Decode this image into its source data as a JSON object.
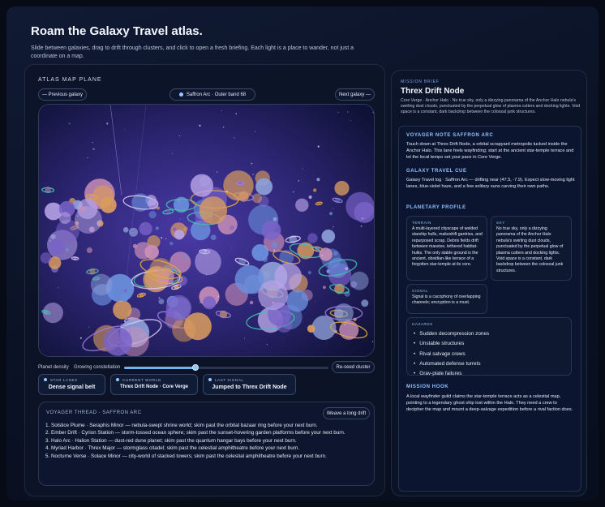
{
  "header": {
    "title": "Roam the Galaxy Travel atlas.",
    "subtitle": "Slide between galaxies, drag to drift through clusters, and click to open a fresh briefing. Each light is a place to wander, not just a coordinate on a map."
  },
  "atlas": {
    "section_label": "ATLAS MAP PLANE",
    "prev_label": "— Previous galaxy",
    "next_label": "Next galaxy —",
    "location_chip": "Saffron Arc · Outer band 68"
  },
  "density": {
    "label": "Planet density",
    "value_text": "Growing constellation",
    "value": 0.35,
    "reseed_label": "Re-seed cluster"
  },
  "stats": [
    {
      "key": "STAR LANES",
      "value": "Dense signal belt"
    },
    {
      "key": "CURRENT WORLD",
      "value": "Threx Drift Node · Core Verge"
    },
    {
      "key": "LAST SIGNAL",
      "value": "Jumped to Threx Drift Node"
    }
  ],
  "thread": {
    "title": "VOYAGER THREAD · SAFFRON ARC",
    "button_label": "Weave a long drift",
    "items": [
      "1. Solstice Plume · Seraphis Minor — nebula-swept shrine world; skim past the orbital bazaar ring before your next burn.",
      "2. Ember Drift · Cyrion Station — storm-tossed ocean sphere; skim past the sunset-hovering garden platforms before your next burn.",
      "3. Halo Arc · Halion Station — dust-red dune planet; skim past the quantum hangar bays before your next burn.",
      "4. Myriad Harbor · Threx Major — stormglass citadel; skim past the celestial amphitheatre before your next burn.",
      "5. Nocturne Verse · Solace Minor — city-world of stacked towers; skim past the celestial amphitheatre before your next burn."
    ]
  },
  "brief": {
    "label": "MISSION BRIEF",
    "title": "Threx Drift Node",
    "summary": "Core Verge · Anchor Halo · No true sky, only a dizzying panorama of the Anchor Halo nebula's swirling dust clouds, punctuated by the perpetual glow of plasma cutters and docking lights. Void space is a constant, dark backdrop between the colossal junk structures.",
    "voyager_note_title": "VOYAGER NOTE SAFFRON ARC",
    "voyager_note": "Touch down at Threx Drift Node, a orbital scrapyard metropolis tucked inside the Anchor Halo. This lane feels wayfinding; start at the ancient star-temple terrace and let the local tempo set your pace in Core Verge.",
    "cue_title": "GALAXY TRAVEL CUE",
    "cue": "Galaxy Travel log · Saffron Arc — drifting near (47.5, -7.9). Expect slow-moving light lanes, blue-violet haze, and a few solitary suns carving their own paths.",
    "profile_title": "PLANETARY PROFILE",
    "terrain_label": "TERRAIN",
    "terrain": "A multi-layered cityscape of welded starship hulls, makeshift gantries, and repurposed scrap. Debris fields drift between massive, tethered habitat-hulks. The only stable ground is the ancient, obsidian-like terrace of a forgotten star-temple at its core.",
    "sky_label": "SKY",
    "sky": "No true sky, only a dizzying panorama of the Anchor Halo nebula's swirling dust clouds, punctuated by the perpetual glow of plasma cutters and docking lights. Void space is a constant, dark backdrop between the colossal junk structures.",
    "signal_label": "SIGNAL",
    "signal": "Signal is a cacophony of overlapping channels; encryption is a must.",
    "hazards_label": "HAZARDS",
    "hazards": [
      "Sudden decompression zones",
      "Unstable structures",
      "Rival salvage crews",
      "Automated defense turrets",
      "Grav-plate failures"
    ],
    "hook_title": "MISSION HOOK",
    "hook": "A local wayfinder guild claims the star-temple terrace acts as a celestial map, pointing to a legendary ghost ship lost within the Halo. They need a crew to decipher the map and mount a deep-salvage expedition before a rival faction does."
  },
  "colors": {
    "accent": "#8ec3ff",
    "map_bg": "#3b2f8a",
    "planet_orange": "#d99b5e",
    "planet_purple": "#7a63c9",
    "planet_blue": "#6a8fdc",
    "ring_teal": "#3fc1b0",
    "ring_gold": "#e0a940"
  }
}
